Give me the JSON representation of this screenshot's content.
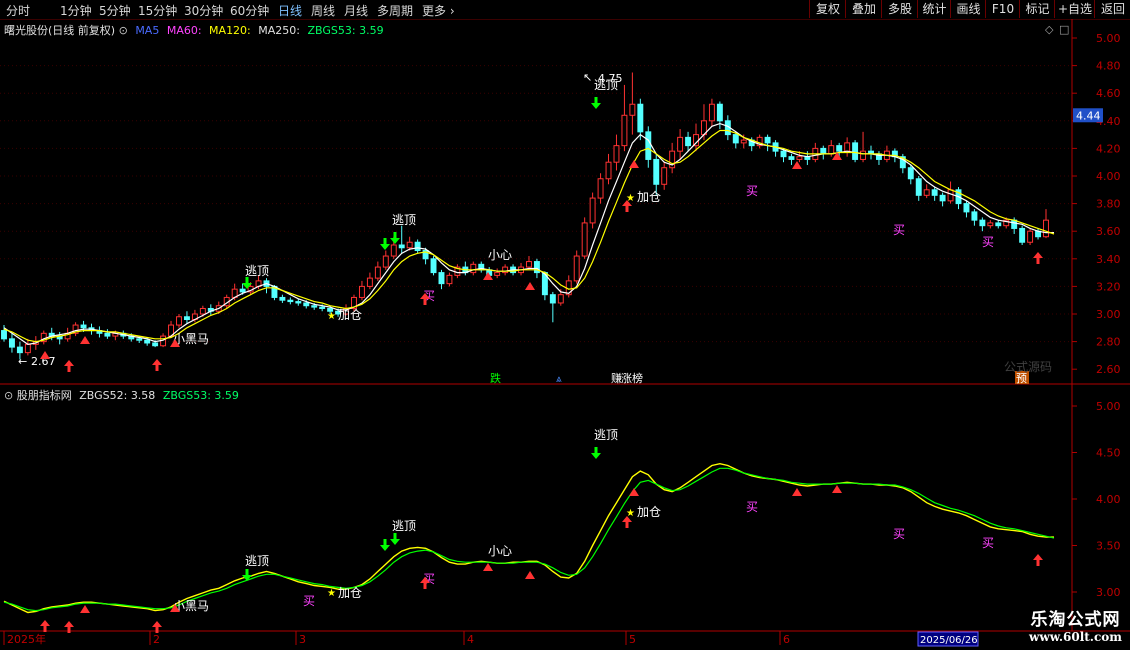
{
  "toolbar": {
    "periods": [
      "分时",
      "1分钟",
      "5分钟",
      "15分钟",
      "30分钟",
      "60分钟",
      "日线",
      "周线",
      "月线",
      "多周期",
      "更多"
    ],
    "active": "日线",
    "right_buttons": [
      "复权",
      "叠加",
      "多股",
      "统计",
      "画线",
      "F10",
      "标记",
      "+自选",
      "返回"
    ]
  },
  "main_info": {
    "title": "曙光股份(日线 前复权)",
    "ma5": "MA5",
    "ma60": "MA60:",
    "ma120": "MA120:",
    "ma250": "MA250:",
    "zbgs53": "ZBGS53: 3.59"
  },
  "sub_info": {
    "title": "股朋指标网",
    "zbgs52": "ZBGS52: 3.58",
    "zbgs53": "ZBGS53: 3.59"
  },
  "price_axis": [
    "5.00",
    "4.80",
    "4.60",
    "4.40",
    "4.20",
    "4.00",
    "3.80",
    "3.60",
    "3.40",
    "3.20",
    "3.00",
    "2.80",
    "2.60"
  ],
  "current_price": "4.44",
  "sub_axis": [
    "5.00",
    "4.50",
    "4.00",
    "3.50",
    "3.00"
  ],
  "annotations": {
    "high": "4.75",
    "low": "2.67",
    "tops": [
      "逃顶",
      "逃顶",
      "逃顶",
      "逃顶"
    ],
    "add": [
      "加仓",
      "加仓"
    ],
    "buy": [
      "买",
      "买",
      "买",
      "买"
    ],
    "careful": "小心",
    "horse": "小黑马"
  },
  "bottom_markers": [
    "跌",
    "赚",
    "涨榜",
    "预"
  ],
  "watermark_formula": "公式源码",
  "date_axis": [
    "2025年",
    "2",
    "3",
    "4",
    "5",
    "6"
  ],
  "date_cursor": "2025/06/26",
  "site": {
    "name": "乐淘公式网",
    "url": "www.60lt.com"
  },
  "colors": {
    "up": "#ff3232",
    "down": "#54ffff",
    "ma_white": "#ffffff",
    "ma_yellow": "#ffff00",
    "ma_green": "#00ff00",
    "frame": "#b00000"
  },
  "chart_data": {
    "type": "candlestick",
    "xlabel": "",
    "ylabel": "",
    "ylim": [
      2.55,
      5.05
    ],
    "dates": [
      "2025-01",
      "2025-02",
      "2025-03",
      "2025-04",
      "2025-05",
      "2025-06"
    ],
    "candles": [
      [
        2.88,
        2.82,
        2.92,
        2.8
      ],
      [
        2.82,
        2.76,
        2.86,
        2.72
      ],
      [
        2.76,
        2.72,
        2.8,
        2.67
      ],
      [
        2.72,
        2.78,
        2.82,
        2.7
      ],
      [
        2.78,
        2.8,
        2.84,
        2.74
      ],
      [
        2.8,
        2.86,
        2.88,
        2.78
      ],
      [
        2.86,
        2.84,
        2.9,
        2.81
      ],
      [
        2.84,
        2.82,
        2.87,
        2.78
      ],
      [
        2.82,
        2.86,
        2.9,
        2.8
      ],
      [
        2.86,
        2.92,
        2.94,
        2.84
      ],
      [
        2.92,
        2.9,
        2.95,
        2.87
      ],
      [
        2.9,
        2.88,
        2.93,
        2.85
      ],
      [
        2.88,
        2.86,
        2.91,
        2.83
      ],
      [
        2.86,
        2.84,
        2.89,
        2.82
      ],
      [
        2.84,
        2.86,
        2.88,
        2.81
      ],
      [
        2.86,
        2.84,
        2.88,
        2.82
      ],
      [
        2.84,
        2.82,
        2.86,
        2.8
      ],
      [
        2.82,
        2.81,
        2.84,
        2.79
      ],
      [
        2.81,
        2.79,
        2.83,
        2.77
      ],
      [
        2.79,
        2.77,
        2.81,
        2.76
      ],
      [
        2.77,
        2.84,
        2.86,
        2.76
      ],
      [
        2.84,
        2.92,
        2.95,
        2.83
      ],
      [
        2.92,
        2.98,
        3.0,
        2.9
      ],
      [
        2.98,
        2.96,
        3.02,
        2.93
      ],
      [
        2.96,
        3.0,
        3.03,
        2.94
      ],
      [
        3.0,
        3.04,
        3.06,
        2.98
      ],
      [
        3.04,
        3.02,
        3.07,
        2.99
      ],
      [
        3.02,
        3.06,
        3.09,
        3.0
      ],
      [
        3.06,
        3.12,
        3.14,
        3.04
      ],
      [
        3.12,
        3.18,
        3.22,
        3.1
      ],
      [
        3.18,
        3.16,
        3.22,
        3.14
      ],
      [
        3.16,
        3.2,
        3.23,
        3.14
      ],
      [
        3.2,
        3.24,
        3.28,
        3.18
      ],
      [
        3.24,
        3.2,
        3.26,
        3.15
      ],
      [
        3.2,
        3.12,
        3.21,
        3.1
      ],
      [
        3.12,
        3.1,
        3.14,
        3.08
      ],
      [
        3.1,
        3.09,
        3.12,
        3.07
      ],
      [
        3.09,
        3.08,
        3.11,
        3.06
      ],
      [
        3.08,
        3.06,
        3.1,
        3.04
      ],
      [
        3.06,
        3.05,
        3.08,
        3.03
      ],
      [
        3.05,
        3.04,
        3.07,
        3.02
      ],
      [
        3.04,
        3.02,
        3.06,
        3.0
      ],
      [
        3.02,
        3.0,
        3.04,
        2.98
      ],
      [
        3.0,
        3.04,
        3.07,
        2.99
      ],
      [
        3.04,
        3.12,
        3.14,
        3.02
      ],
      [
        3.12,
        3.2,
        3.24,
        3.1
      ],
      [
        3.2,
        3.26,
        3.3,
        3.18
      ],
      [
        3.26,
        3.34,
        3.38,
        3.24
      ],
      [
        3.34,
        3.42,
        3.46,
        3.32
      ],
      [
        3.42,
        3.5,
        3.56,
        3.4
      ],
      [
        3.5,
        3.48,
        3.64,
        3.44
      ],
      [
        3.48,
        3.52,
        3.56,
        3.46
      ],
      [
        3.52,
        3.46,
        3.54,
        3.44
      ],
      [
        3.46,
        3.4,
        3.48,
        3.36
      ],
      [
        3.4,
        3.3,
        3.42,
        3.28
      ],
      [
        3.3,
        3.22,
        3.32,
        3.18
      ],
      [
        3.22,
        3.28,
        3.3,
        3.2
      ],
      [
        3.28,
        3.34,
        3.36,
        3.26
      ],
      [
        3.34,
        3.3,
        3.38,
        3.28
      ],
      [
        3.3,
        3.36,
        3.38,
        3.28
      ],
      [
        3.36,
        3.32,
        3.38,
        3.3
      ],
      [
        3.32,
        3.28,
        3.34,
        3.26
      ],
      [
        3.28,
        3.3,
        3.33,
        3.26
      ],
      [
        3.3,
        3.34,
        3.36,
        3.28
      ],
      [
        3.34,
        3.3,
        3.36,
        3.28
      ],
      [
        3.3,
        3.34,
        3.37,
        3.28
      ],
      [
        3.34,
        3.38,
        3.42,
        3.32
      ],
      [
        3.38,
        3.3,
        3.4,
        3.26
      ],
      [
        3.3,
        3.14,
        3.31,
        3.1
      ],
      [
        3.14,
        3.08,
        3.16,
        2.94
      ],
      [
        3.08,
        3.14,
        3.18,
        3.06
      ],
      [
        3.14,
        3.24,
        3.28,
        3.12
      ],
      [
        3.24,
        3.42,
        3.46,
        3.22
      ],
      [
        3.42,
        3.66,
        3.7,
        3.4
      ],
      [
        3.66,
        3.84,
        3.88,
        3.62
      ],
      [
        3.84,
        3.98,
        4.02,
        3.8
      ],
      [
        3.98,
        4.1,
        4.16,
        3.94
      ],
      [
        4.1,
        4.22,
        4.3,
        4.04
      ],
      [
        4.22,
        4.44,
        4.66,
        4.18
      ],
      [
        4.44,
        4.52,
        4.75,
        4.3
      ],
      [
        4.52,
        4.32,
        4.56,
        4.26
      ],
      [
        4.32,
        4.12,
        4.36,
        4.06
      ],
      [
        4.12,
        3.94,
        4.16,
        3.86
      ],
      [
        3.94,
        4.06,
        4.1,
        3.9
      ],
      [
        4.06,
        4.18,
        4.24,
        4.02
      ],
      [
        4.18,
        4.28,
        4.34,
        4.12
      ],
      [
        4.28,
        4.22,
        4.32,
        4.18
      ],
      [
        4.22,
        4.3,
        4.38,
        4.18
      ],
      [
        4.3,
        4.4,
        4.52,
        4.26
      ],
      [
        4.4,
        4.52,
        4.56,
        4.36
      ],
      [
        4.52,
        4.4,
        4.54,
        4.34
      ],
      [
        4.4,
        4.3,
        4.44,
        4.26
      ],
      [
        4.3,
        4.24,
        4.32,
        4.2
      ],
      [
        4.24,
        4.26,
        4.3,
        4.2
      ],
      [
        4.26,
        4.22,
        4.28,
        4.18
      ],
      [
        4.22,
        4.28,
        4.3,
        4.2
      ],
      [
        4.28,
        4.24,
        4.3,
        4.18
      ],
      [
        4.24,
        4.18,
        4.26,
        4.14
      ],
      [
        4.18,
        4.14,
        4.2,
        4.1
      ],
      [
        4.14,
        4.12,
        4.16,
        4.08
      ],
      [
        4.12,
        4.14,
        4.18,
        4.1
      ],
      [
        4.14,
        4.12,
        4.18,
        4.08
      ],
      [
        4.12,
        4.2,
        4.24,
        4.1
      ],
      [
        4.2,
        4.16,
        4.22,
        4.12
      ],
      [
        4.16,
        4.22,
        4.26,
        4.14
      ],
      [
        4.22,
        4.18,
        4.24,
        4.14
      ],
      [
        4.18,
        4.24,
        4.28,
        4.14
      ],
      [
        4.24,
        4.12,
        4.26,
        4.1
      ],
      [
        4.12,
        4.18,
        4.32,
        4.1
      ],
      [
        4.18,
        4.16,
        4.22,
        4.12
      ],
      [
        4.16,
        4.12,
        4.18,
        4.08
      ],
      [
        4.12,
        4.18,
        4.22,
        4.1
      ],
      [
        4.18,
        4.14,
        4.2,
        4.1
      ],
      [
        4.14,
        4.06,
        4.16,
        4.02
      ],
      [
        4.06,
        3.98,
        4.08,
        3.94
      ],
      [
        3.98,
        3.86,
        4.0,
        3.82
      ],
      [
        3.86,
        3.9,
        3.94,
        3.84
      ],
      [
        3.9,
        3.86,
        3.92,
        3.82
      ],
      [
        3.86,
        3.82,
        3.88,
        3.78
      ],
      [
        3.82,
        3.9,
        3.96,
        3.8
      ],
      [
        3.9,
        3.8,
        3.92,
        3.76
      ],
      [
        3.8,
        3.74,
        3.82,
        3.7
      ],
      [
        3.74,
        3.68,
        3.76,
        3.64
      ],
      [
        3.68,
        3.64,
        3.7,
        3.6
      ],
      [
        3.64,
        3.66,
        3.68,
        3.62
      ],
      [
        3.66,
        3.64,
        3.68,
        3.62
      ],
      [
        3.64,
        3.68,
        3.7,
        3.62
      ],
      [
        3.68,
        3.62,
        3.7,
        3.58
      ],
      [
        3.62,
        3.52,
        3.64,
        3.5
      ],
      [
        3.52,
        3.6,
        3.62,
        3.5
      ],
      [
        3.6,
        3.56,
        3.62,
        3.54
      ],
      [
        3.56,
        3.68,
        3.76,
        3.55
      ]
    ],
    "series": [
      {
        "values": [
          2.9,
          2.86,
          2.82,
          2.78,
          2.79,
          2.82,
          2.84,
          2.85,
          2.86,
          2.88,
          2.89,
          2.89,
          2.88,
          2.87,
          2.86,
          2.85,
          2.84,
          2.83,
          2.82,
          2.8,
          2.81,
          2.84,
          2.89,
          2.93,
          2.96,
          2.99,
          3.02,
          3.04,
          3.08,
          3.12,
          3.15,
          3.17,
          3.2,
          3.22,
          3.2,
          3.17,
          3.14,
          3.11,
          3.09,
          3.07,
          3.06,
          3.05,
          3.03,
          3.03,
          3.05,
          3.08,
          3.14,
          3.22,
          3.3,
          3.38,
          3.44,
          3.47,
          3.48,
          3.47,
          3.43,
          3.37,
          3.32,
          3.3,
          3.3,
          3.32,
          3.33,
          3.32,
          3.31,
          3.31,
          3.32,
          3.32,
          3.33,
          3.33,
          3.29,
          3.22,
          3.16,
          3.15,
          3.2,
          3.33,
          3.5,
          3.66,
          3.82,
          3.96,
          4.1,
          4.24,
          4.3,
          4.26,
          4.16,
          4.1,
          4.08,
          4.12,
          4.18,
          4.24,
          4.3,
          4.36,
          4.38,
          4.36,
          4.32,
          4.28,
          4.25,
          4.23,
          4.22,
          4.21,
          4.19,
          4.17,
          4.15,
          4.14,
          4.15,
          4.16,
          4.16,
          4.17,
          4.18,
          4.17,
          4.16,
          4.16,
          4.15,
          4.15,
          4.14,
          4.12,
          4.08,
          4.02,
          3.96,
          3.92,
          3.89,
          3.87,
          3.85,
          3.82,
          3.78,
          3.74,
          3.7,
          3.68,
          3.67,
          3.66,
          3.65,
          3.62,
          3.6,
          3.59,
          3.59
        ]
      },
      {
        "values": [
          2.89,
          2.87,
          2.84,
          2.81,
          2.8,
          2.81,
          2.83,
          2.84,
          2.85,
          2.87,
          2.88,
          2.88,
          2.88,
          2.87,
          2.87,
          2.86,
          2.85,
          2.84,
          2.83,
          2.82,
          2.82,
          2.83,
          2.86,
          2.9,
          2.93,
          2.96,
          2.99,
          3.01,
          3.04,
          3.08,
          3.11,
          3.14,
          3.17,
          3.19,
          3.19,
          3.17,
          3.15,
          3.13,
          3.11,
          3.09,
          3.08,
          3.06,
          3.05,
          3.04,
          3.05,
          3.07,
          3.11,
          3.17,
          3.24,
          3.32,
          3.38,
          3.42,
          3.44,
          3.45,
          3.43,
          3.39,
          3.35,
          3.33,
          3.32,
          3.32,
          3.32,
          3.32,
          3.31,
          3.31,
          3.31,
          3.32,
          3.32,
          3.32,
          3.3,
          3.26,
          3.21,
          3.18,
          3.19,
          3.26,
          3.38,
          3.52,
          3.67,
          3.81,
          3.95,
          4.08,
          4.18,
          4.2,
          4.16,
          4.12,
          4.09,
          4.1,
          4.14,
          4.19,
          4.24,
          4.29,
          4.33,
          4.33,
          4.31,
          4.28,
          4.26,
          4.24,
          4.22,
          4.21,
          4.2,
          4.18,
          4.17,
          4.16,
          4.16,
          4.16,
          4.16,
          4.17,
          4.17,
          4.17,
          4.16,
          4.16,
          4.16,
          4.15,
          4.15,
          4.13,
          4.1,
          4.06,
          4.01,
          3.96,
          3.93,
          3.9,
          3.88,
          3.85,
          3.82,
          3.78,
          3.74,
          3.71,
          3.69,
          3.68,
          3.66,
          3.64,
          3.62,
          3.6,
          3.58
        ]
      }
    ]
  }
}
